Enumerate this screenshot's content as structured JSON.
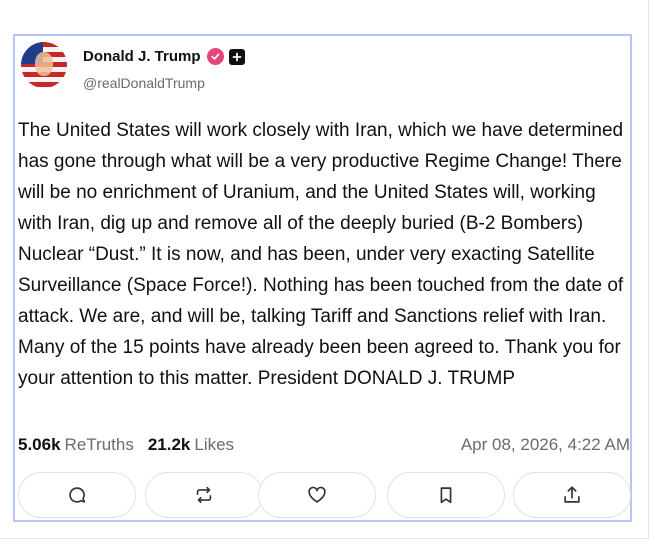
{
  "author": {
    "display_name": "Donald J. Trump",
    "handle": "@realDonaldTrump",
    "avatar_icon": "avatar-flag-portrait",
    "verified_icon": "verified-badge-icon",
    "extra_badge_icon": "plus-badge-icon"
  },
  "post": {
    "text": "The United States will work closely with Iran, which we have determined has gone through what will be a very productive Regime Change! There will be no enrichment of Uranium, and the United States will, working with Iran, dig up and remove all of the deeply buried (B-2 Bombers) Nuclear “Dust.” It is now, and has been, under very exacting Satellite Surveillance (Space Force!). Nothing has been touched from the date of attack. We are, and will be, talking Tariff and Sanctions relief with Iran. Many of the 15 points have already been been agreed to. Thank you for your attention to this matter. President DONALD J. TRUMP"
  },
  "stats": {
    "retruths_count": "5.06k",
    "retruths_label": "ReTruths",
    "likes_count": "21.2k",
    "likes_label": "Likes",
    "timestamp": "Apr 08, 2026, 4:22 AM"
  },
  "actions": [
    {
      "icon": "reply-icon"
    },
    {
      "icon": "retruth-icon"
    },
    {
      "icon": "like-icon"
    },
    {
      "icon": "bookmark-icon"
    },
    {
      "icon": "share-icon"
    }
  ],
  "colors": {
    "card_border": "#b8c2ff",
    "verified_badge": "#e2477a",
    "secondary_text": "#6b6b6b"
  }
}
